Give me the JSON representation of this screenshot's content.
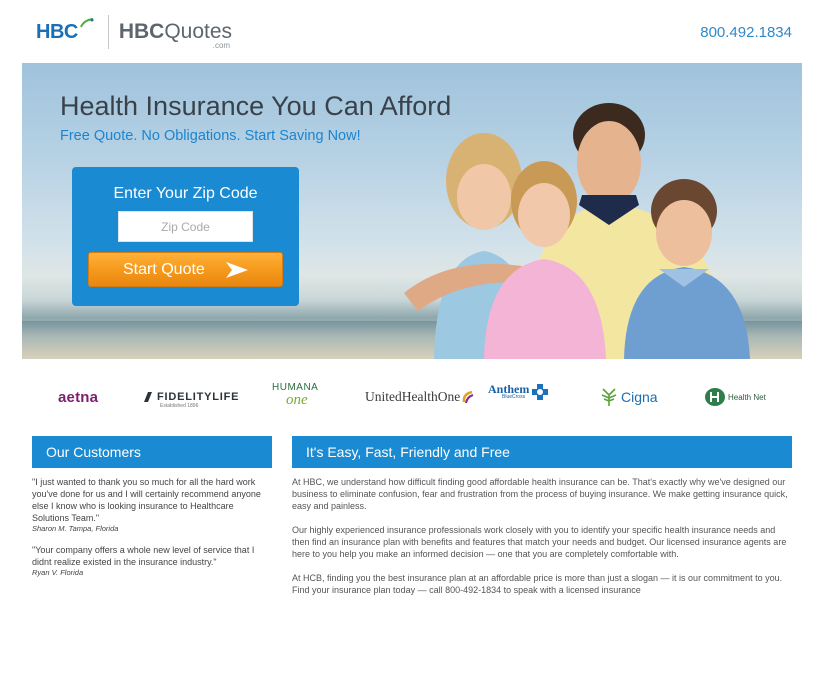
{
  "header": {
    "logo_hbc": "HBC",
    "logo_quotes_bold": "HBC",
    "logo_quotes_rest": "Quotes",
    "logo_com": ".com",
    "phone": "800.492.1834"
  },
  "hero": {
    "title": "Health Insurance You Can Afford",
    "subtitle": "Free Quote. No Obligations. Start Saving Now!",
    "zip_label": "Enter Your Zip Code",
    "zip_placeholder": "Zip Code",
    "zip_value": "",
    "button_label": "Start Quote"
  },
  "insurers": [
    "aetna",
    "FIDELITYLIFE",
    "HUMANA",
    "one",
    "UnitedHealthOne",
    "Anthem",
    "BlueCross",
    "Cigna",
    "Health Net"
  ],
  "insurer_fine": "Established 1896",
  "customers": {
    "heading": "Our Customers",
    "items": [
      {
        "quote": "\"I just wanted to thank you so much for all the hard work you've done for us and I will certainly recommend anyone else I know who is looking insurance to Healthcare Solutions Team.\"",
        "author": "Sharon M. Tampa, Florida"
      },
      {
        "quote": "\"Your company offers a whole new level of service that I didnt realize existed in the insurance industry.\"",
        "author": "Ryan V. Florida"
      }
    ]
  },
  "about": {
    "heading": "It's Easy, Fast, Friendly and Free",
    "paragraphs": [
      "At HBC, we understand how difficult finding good affordable health insurance can be. That's exactly why we've designed our business to eliminate confusion, fear and frustration from the process of buying insurance. We make getting insurance quick, easy and painless.",
      "Our highly experienced insurance professionals work closely with you to identify your specific health insurance needs and then find an insurance plan with benefits and features that match your needs and budget. Our licensed insurance agents are here to you help you make an informed decision — one that you are completely comfortable with.",
      "At HCB, finding you the best insurance plan at an affordable price is more than just a slogan — it is our commitment to you. Find your insurance plan today — call 800-492-1834 to speak with a licensed insurance"
    ]
  },
  "colors": {
    "brand_blue": "#1a8ad2",
    "cta_orange": "#f59a1c"
  }
}
